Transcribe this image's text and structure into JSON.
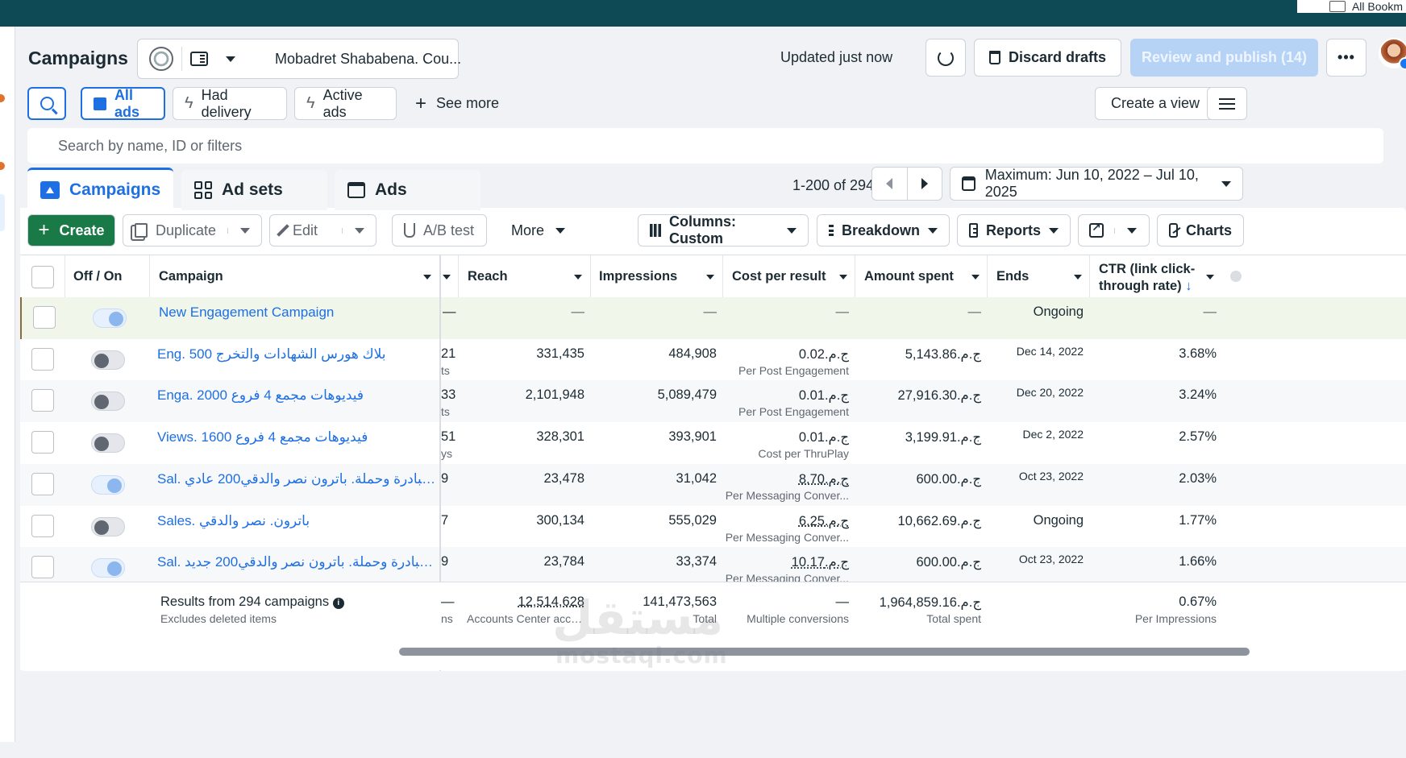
{
  "browser": {
    "bookmarks_label": "All Bookm"
  },
  "header": {
    "title": "Campaigns",
    "account_name": "Mobadret Shababena. Cou...",
    "updated": "Updated just now",
    "discard": "Discard drafts",
    "publish": "Review and publish (14)",
    "more": "•••"
  },
  "filters": {
    "all_ads": "All ads",
    "had_delivery": "Had delivery",
    "active_ads": "Active ads",
    "see_more": "See more",
    "create_view": "Create a view",
    "search_placeholder": "Search by name, ID or filters"
  },
  "tabs": {
    "campaigns": "Campaigns",
    "ad_sets": "Ad sets",
    "ads": "Ads"
  },
  "pagination": {
    "range": "1-200 of 294"
  },
  "date_range": "Maximum: Jun 10, 2022 – Jul 10, 2025",
  "toolbar": {
    "create": "Create",
    "duplicate": "Duplicate",
    "edit": "Edit",
    "ab_test": "A/B test",
    "more": "More",
    "columns": "Columns: Custom",
    "breakdown": "Breakdown",
    "reports": "Reports",
    "charts": "Charts"
  },
  "table": {
    "headers": {
      "off_on": "Off / On",
      "campaign": "Campaign",
      "reach": "Reach",
      "impressions": "Impressions",
      "cost": "Cost per result",
      "spent": "Amount spent",
      "ends": "Ends",
      "ctr1": "CTR (link click-",
      "ctr2": "through rate)",
      "ctr_sort": "↓"
    },
    "rows": [
      {
        "on": true,
        "name": "New Engagement Campaign",
        "clip": "—",
        "clip_sub": "",
        "reach": "—",
        "impressions": "—",
        "cost": "—",
        "cost_sub": "",
        "spent": "—",
        "ends": "Ongoing",
        "ctr": "—"
      },
      {
        "on": false,
        "name": "Eng. 500 بلاك هورس الشهادات والتخرج",
        "clip": "21",
        "clip_sub": "ts",
        "reach": "331,435",
        "impressions": "484,908",
        "cost": "ج.م.0.02",
        "cost_sub": "Per Post Engagement",
        "spent": "ج.م.5,143.86",
        "ends": "Dec 14, 2022",
        "ctr": "3.68%"
      },
      {
        "on": false,
        "name": "Enga. 2000 فيديوهات مجمع 4 فروع",
        "clip": "33",
        "clip_sub": "ts",
        "reach": "2,101,948",
        "impressions": "5,089,479",
        "cost": "ج.م.0.01",
        "cost_sub": "Per Post Engagement",
        "spent": "ج.م.27,916.30",
        "ends": "Dec 20, 2022",
        "ctr": "3.24%"
      },
      {
        "on": false,
        "name": "Views. 1600 فيديوهات مجمع 4 فروع",
        "clip": "51",
        "clip_sub": "ys",
        "reach": "328,301",
        "impressions": "393,901",
        "cost": "ج.م.0.01",
        "cost_sub": "Cost per ThruPlay",
        "spent": "ج.م.3,199.91",
        "ends": "Dec 2, 2022",
        "ctr": "2.57%"
      },
      {
        "on": true,
        "name": "Sal. ت مبادرة وحملة. باترون نصر والدقي200 عادي...",
        "clip": "9",
        "clip_sub": "",
        "reach": "23,478",
        "impressions": "31,042",
        "cost": "ج.م.8.70",
        "cost_sub": "Per Messaging Conver...",
        "spent": "ج.م.600.00",
        "ends": "Oct 23, 2022",
        "ctr": "2.03%"
      },
      {
        "on": false,
        "name": "Sales. باترون. نصر والدقي",
        "clip": "7",
        "clip_sub": "",
        "reach": "300,134",
        "impressions": "555,029",
        "cost": "ج.م.6.25",
        "cost_sub": "Per Messaging Conver...",
        "spent": "ج.م.10,662.69",
        "ends": "Ongoing",
        "ctr": "1.77%"
      },
      {
        "on": true,
        "name": "Sal. ت مبادرة وحملة. باترون نصر والدقي200 جديد...",
        "clip": "9",
        "clip_sub": "",
        "reach": "23,784",
        "impressions": "33,374",
        "cost": "ج.م.10.17",
        "cost_sub": "Per Messaging Conver...",
        "spent": "ج.م.600.00",
        "ends": "Oct 23, 2022",
        "ctr": "1.66%"
      }
    ],
    "footer": {
      "results": "Results from 294 campaigns",
      "excludes": "Excludes deleted items",
      "clip": "—",
      "clip_sub": "ns",
      "reach": "12,514,628",
      "reach_sub": "Accounts Center accou...",
      "impressions": "141,473,563",
      "impressions_sub": "Total",
      "cost": "—",
      "cost_sub": "Multiple conversions",
      "spent": "ج.م.1,964,859.16",
      "spent_sub": "Total spent",
      "ctr": "0.67%",
      "ctr_sub": "Per Impressions"
    }
  },
  "watermark": {
    "arabic": "مستقل",
    "latin": "mostaql.com"
  }
}
